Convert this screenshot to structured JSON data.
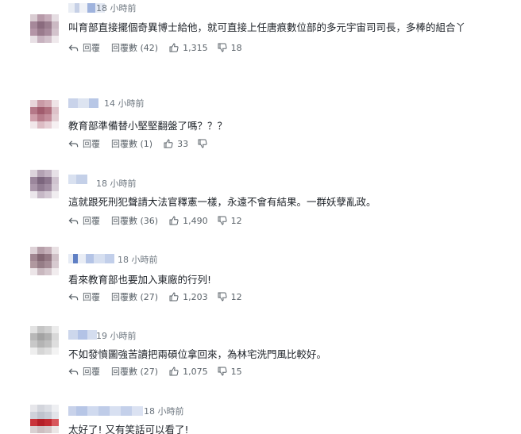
{
  "comments": [
    {
      "time": "18 小時前",
      "text": "叫育部直接擺個奇異博士給他，就可直接上任唐痕數位部的多元宇宙司司長，多棒的組合丫",
      "reply": "回覆",
      "replies": "回覆數 (42)",
      "likes": "1,315",
      "dislikes": "18"
    },
    {
      "time": "14 小時前",
      "text": "教育部準備替小堅堅翻盤了嗎？？？",
      "reply": "回覆",
      "replies": "回覆數 (1)",
      "likes": "33",
      "dislikes": ""
    },
    {
      "time": "18 小時前",
      "text": "這就跟死刑犯聲請大法官釋憲一樣，永遠不會有結果。一群妖孽亂政。",
      "reply": "回覆",
      "replies": "回覆數 (36)",
      "likes": "1,490",
      "dislikes": "12"
    },
    {
      "time": "18 小時前",
      "text": "看來教育部也要加入東廠的行列!",
      "reply": "回覆",
      "replies": "回覆數 (27)",
      "likes": "1,203",
      "dislikes": "12"
    },
    {
      "time": "19 小時前",
      "text": "不如發憤圖強苦讀把兩碩位拿回來，為林宅洗門風比較好。",
      "reply": "回覆",
      "replies": "回覆數 (27)",
      "likes": "1,075",
      "dislikes": "15"
    },
    {
      "time": "18 小時前",
      "text": "太好了! 又有笑話可以看了!",
      "reply": "",
      "replies": "",
      "likes": "",
      "dislikes": ""
    }
  ]
}
